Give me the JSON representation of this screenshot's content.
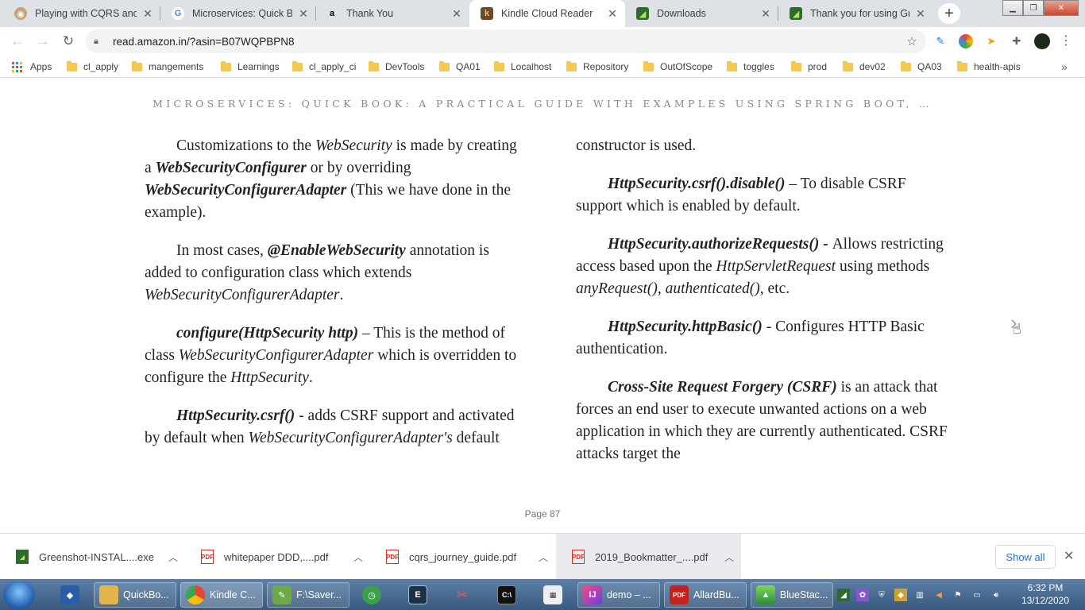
{
  "tabs": [
    {
      "title": "Playing with CQRS and E",
      "icon": "avatar-icon"
    },
    {
      "title": "Microservices: Quick Boo",
      "icon": "google-icon"
    },
    {
      "title": "Thank You",
      "icon": "amazon-icon"
    },
    {
      "title": "Kindle Cloud Reader",
      "icon": "kindle-icon",
      "active": true
    },
    {
      "title": "Downloads",
      "icon": "greenshot-icon"
    },
    {
      "title": "Thank you for using Gre",
      "icon": "greenshot-icon"
    }
  ],
  "toolbar": {
    "url": "read.amazon.in/?asin=B07WQPBPN8"
  },
  "bookmarks": {
    "apps_label": "Apps",
    "items": [
      "cl_apply",
      "mangements",
      "Learnings",
      "cl_apply_ci",
      "DevTools",
      "QA01",
      "Localhost",
      "Repository",
      "OutOfScope",
      "toggles",
      "prod",
      "dev02",
      "QA03",
      "health-apis"
    ],
    "more": "»"
  },
  "reader": {
    "book_title": "MICROSERVICES: QUICK BOOK: A PRACTICAL GUIDE WITH EXAMPLES USING SPRING BOOT, …",
    "page_label": "Page 87",
    "left_column": {
      "p1": {
        "t1": "Customizations to the ",
        "t2": "WebSecurity",
        "t3": " is made by creating a ",
        "t4": "WebSecurityConfigurer",
        "t5": " or by overriding ",
        "t6": "WebSecurityConfigurerAdapter",
        "t7": " (This we have done in the example)."
      },
      "p2": {
        "t1": "In most cases, ",
        "t2": "@EnableWebSecurity",
        "t3": " annotation is added to configuration class which extends ",
        "t4": "WebSecurityConfigurerAdapter",
        "t5": "."
      },
      "p3": {
        "t1": "configure(HttpSecurity http)",
        "t2": " – This is the method of class ",
        "t3": "WebSecurityConfigurerAdapter",
        "t4": " which is overridden to configure the ",
        "t5": "HttpSecurity",
        "t6": "."
      },
      "p4": {
        "t1": "HttpSecurity.csrf()",
        "t2": " - adds CSRF support and activated by default when ",
        "t3": "WebSecurityConfigurerAdapter's",
        "t4": " default"
      }
    },
    "right_column": {
      "p0": "constructor is used.",
      "p1": {
        "t1": "HttpSecurity.csrf().disable()",
        "t2": " – To disable CSRF support which is enabled by default."
      },
      "p2": {
        "t1": "HttpSecurity.authorizeRequests()",
        "t2": " - ",
        "t3": "Allows restricting access based upon the ",
        "t4": "HttpServletRequest",
        "t5": " using methods ",
        "t6": "anyRequest(), authenticated()",
        "t7": ", etc."
      },
      "p3": {
        "t1": "HttpSecurity.httpBasic()",
        "t2": " - Configures HTTP Basic authentication."
      },
      "p4": {
        "t1": "Cross-Site Request Forgery (CSRF)",
        "t2": " is an attack that forces an end user to execute unwanted actions on a web application in which they are currently authenticated. CSRF attacks target the"
      }
    }
  },
  "downloads": {
    "items": [
      {
        "name": "Greenshot-INSTAL....exe",
        "icon": "exe-icon"
      },
      {
        "name": "whitepaper DDD,....pdf",
        "icon": "pdf-icon"
      },
      {
        "name": "cqrs_journey_guide.pdf",
        "icon": "pdf-icon"
      },
      {
        "name": "2019_Bookmatter_....pdf",
        "icon": "pdf-icon"
      }
    ],
    "show_all": "Show all"
  },
  "taskbar": {
    "items": [
      {
        "label": "QuickBo...",
        "icon": "folder-icon"
      },
      {
        "label": "Kindle C...",
        "icon": "chrome-icon"
      },
      {
        "label": "F:\\Saver...",
        "icon": "editor-icon"
      },
      {
        "label": "",
        "icon": "clock-app-icon"
      },
      {
        "label": "",
        "icon": "editor-e-icon"
      },
      {
        "label": "",
        "icon": "snipping-icon"
      },
      {
        "label": "",
        "icon": "cmd-icon"
      },
      {
        "label": "",
        "icon": "calendar-icon"
      },
      {
        "label": "demo – ...",
        "icon": "intellij-icon"
      },
      {
        "label": "AllardBu...",
        "icon": "pdf-reader-icon"
      },
      {
        "label": "BlueStac...",
        "icon": "bluestacks-icon"
      }
    ],
    "time": "6:32 PM",
    "date": "13/12/2020"
  }
}
